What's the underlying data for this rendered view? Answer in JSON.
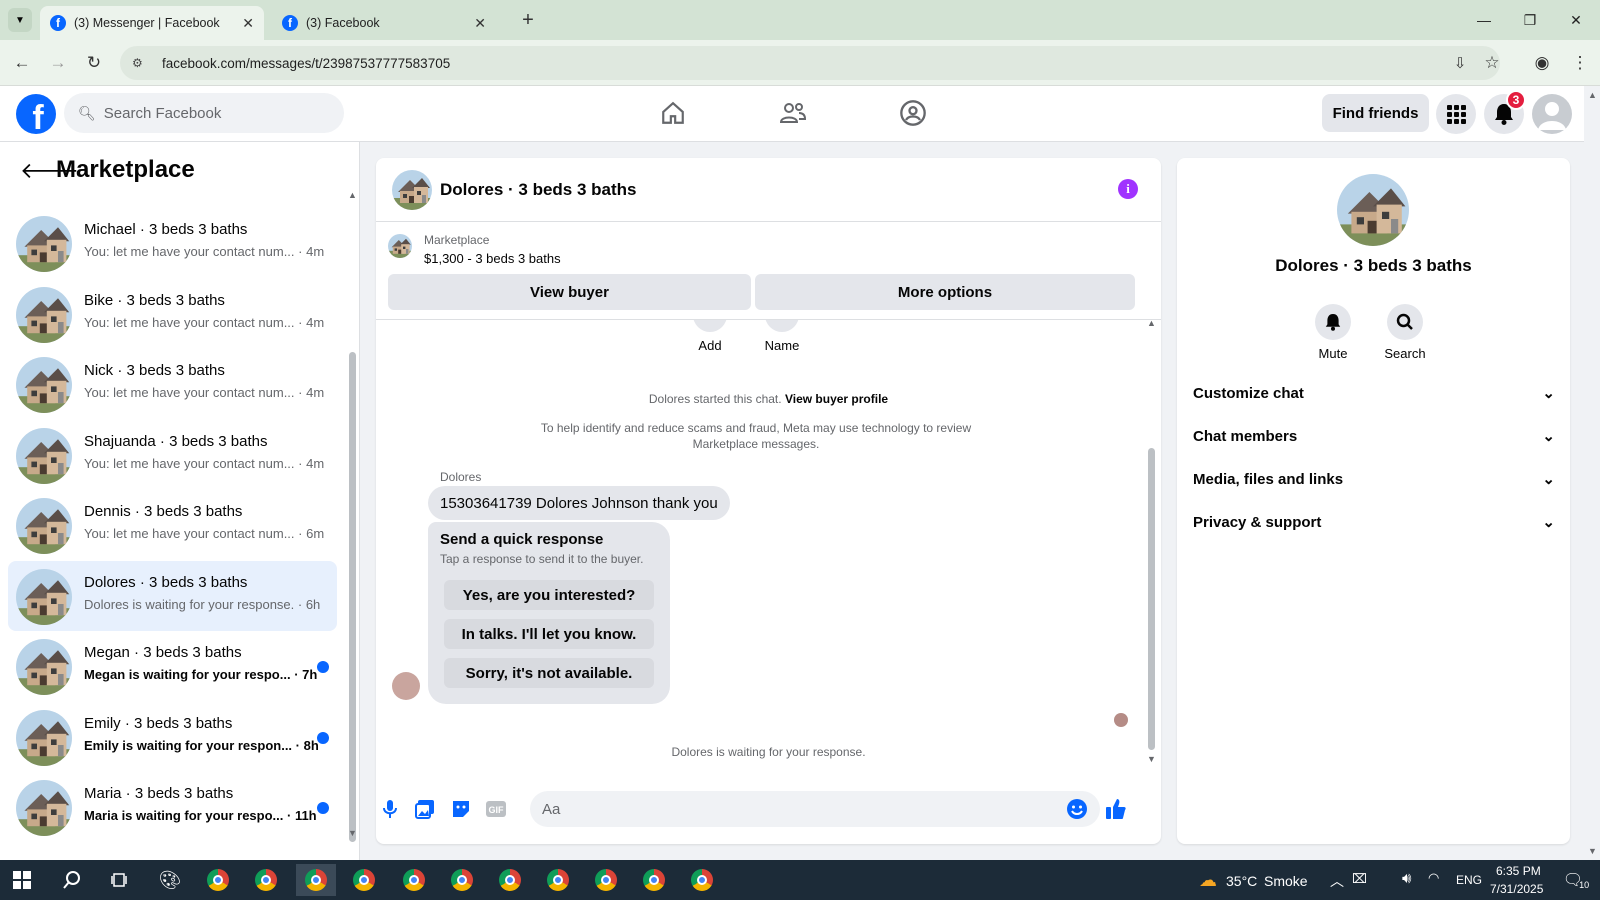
{
  "browser": {
    "tabs": [
      {
        "label": "(3) Messenger | Facebook",
        "active": true
      },
      {
        "label": "(3) Facebook",
        "active": false
      }
    ],
    "url": "facebook.com/messages/t/23987537777583705"
  },
  "header": {
    "search_placeholder": "Search Facebook",
    "find_friends": "Find friends",
    "notification_count": "3"
  },
  "sidebar": {
    "title": "Marketplace",
    "conversations": [
      {
        "name": "Michael · 3 beds 3 baths",
        "snippet": "You: let me have your contact num...",
        "time": "· 4m",
        "unread": false,
        "selected": false
      },
      {
        "name": "Bike · 3 beds 3 baths",
        "snippet": "You: let me have your contact num...",
        "time": "· 4m",
        "unread": false,
        "selected": false
      },
      {
        "name": "Nick · 3 beds 3 baths",
        "snippet": "You: let me have your contact num...",
        "time": "· 4m",
        "unread": false,
        "selected": false
      },
      {
        "name": "Shajuanda · 3 beds 3 baths",
        "snippet": "You: let me have your contact num...",
        "time": "· 4m",
        "unread": false,
        "selected": false
      },
      {
        "name": "Dennis · 3 beds 3 baths",
        "snippet": "You: let me have your contact num...",
        "time": "· 6m",
        "unread": false,
        "selected": false
      },
      {
        "name": "Dolores · 3 beds 3 baths",
        "snippet": "Dolores is waiting for your response.",
        "time": "· 6h",
        "unread": false,
        "selected": true
      },
      {
        "name": "Megan · 3 beds 3 baths",
        "snippet": "Megan is waiting for your respo...",
        "time": "· 7h",
        "unread": true,
        "selected": false
      },
      {
        "name": "Emily · 3 beds 3 baths",
        "snippet": "Emily is waiting for your respon...",
        "time": "· 8h",
        "unread": true,
        "selected": false
      },
      {
        "name": "Maria · 3 beds 3 baths",
        "snippet": "Maria is waiting for your respo...",
        "time": "· 11h",
        "unread": true,
        "selected": false
      }
    ]
  },
  "chat": {
    "title": "Dolores · 3 beds 3 baths",
    "listing_source": "Marketplace",
    "listing_price": "$1,300 - 3 beds 3 baths",
    "view_buyer": "View buyer",
    "more_options": "More options",
    "actions": [
      "Add",
      "Name"
    ],
    "started_text": "Dolores started this chat.",
    "view_profile": "View buyer profile",
    "notice": "To help identify and reduce scams and fraud, Meta may use technology to review Marketplace messages.",
    "sender": "Dolores",
    "message": "15303641739 Dolores Johnson thank you",
    "quick_title": "Send a quick response",
    "quick_sub": "Tap a response to send it to the buyer.",
    "quick_replies": [
      "Yes, are you interested?",
      "In talks. I'll let you know.",
      "Sorry, it's not available."
    ],
    "waiting": "Dolores is waiting for your response.",
    "input_placeholder": "Aa"
  },
  "info": {
    "name": "Dolores · 3 beds 3 baths",
    "mute": "Mute",
    "search": "Search",
    "sections": [
      "Customize chat",
      "Chat members",
      "Media, files and links",
      "Privacy & support"
    ]
  },
  "taskbar": {
    "temperature": "35°C",
    "weather": "Smoke",
    "language": "ENG",
    "time": "6:35 PM",
    "date": "7/31/2025",
    "notif_count": "10"
  },
  "colors": {
    "brand": "#0866ff",
    "selected_bg": "#e7f0fd",
    "info_purple": "#a033ff"
  }
}
